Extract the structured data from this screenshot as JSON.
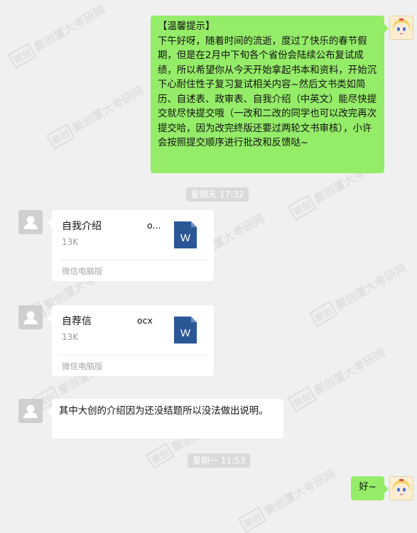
{
  "watermark": {
    "seal": "聚创",
    "text": "聚创厦大考研网"
  },
  "messages": {
    "m1": {
      "title": "【温馨提示】",
      "body": "下午好呀，随着时间的流逝，度过了快乐的春节假期，但是在2月中下旬各个省份会陆续公布复试成绩，所以希望你从今天开始拿起书本和资料，开始沉下心耐住性子复习复试相关内容~然后文书类如简历、自述表、政审表、自我介绍（中英文）能尽快提交就尽快提交哦（一改和二改的同学也可以改完再次提交哈，因为改完终版还要过两轮文书审核），小许会按照提交顺序进行批改和反馈哒~"
    },
    "time1": "星期天 17:32",
    "file1": {
      "name": "自我介绍",
      "ext": "o...",
      "size": "13K",
      "source": "微信电脑版",
      "icon_letter": "W"
    },
    "file2": {
      "name": "自荐信",
      "ext": "ocx",
      "size": "13K",
      "source": "微信电脑版",
      "icon_letter": "W"
    },
    "m2": {
      "body": "其中大创的介绍因为还没结题所以没法做出说明。"
    },
    "time2": "星期一 11:53",
    "m3": {
      "body": "好~"
    }
  },
  "icons": {
    "default_avatar": "person-silhouette-icon",
    "self_avatar": "anime-avatar-icon",
    "file_type": "word-document-icon"
  },
  "colors": {
    "background": "#f0f0f0",
    "my_bubble": "#95ec69",
    "other_bubble": "#ffffff",
    "word_blue": "#2b5797"
  }
}
